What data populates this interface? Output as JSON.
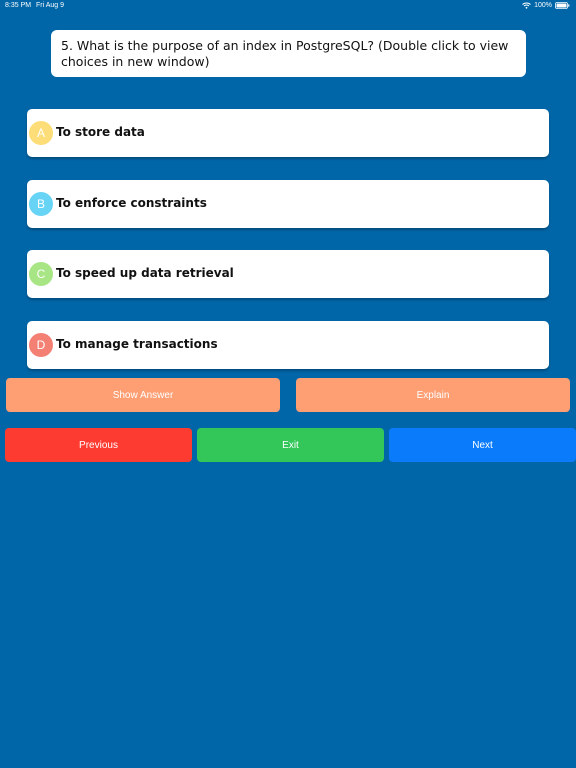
{
  "status_bar": {
    "time": "8:35 PM",
    "date": "Fri Aug 9",
    "battery": "100%",
    "wifi_icon": "wifi-icon",
    "battery_icon": "battery-icon"
  },
  "question": {
    "text": "5. What is the purpose of an index in PostgreSQL? (Double click to view choices in new window)"
  },
  "choices": [
    {
      "letter": "A",
      "text": "To store data",
      "color": "#fddd77"
    },
    {
      "letter": "B",
      "text": "To enforce constraints",
      "color": "#67d3f5"
    },
    {
      "letter": "C",
      "text": "To speed up data retrieval",
      "color": "#a7e585"
    },
    {
      "letter": "D",
      "text": "To manage transactions",
      "color": "#f47f73"
    }
  ],
  "actions": {
    "show_answer": "Show Answer",
    "explain": "Explain",
    "previous": "Previous",
    "exit": "Exit",
    "next": "Next"
  },
  "colors": {
    "background": "#0066a8",
    "action_orange": "#fd9e73",
    "previous": "#fe3b31",
    "exit": "#33c659",
    "next": "#0a7bfb"
  }
}
